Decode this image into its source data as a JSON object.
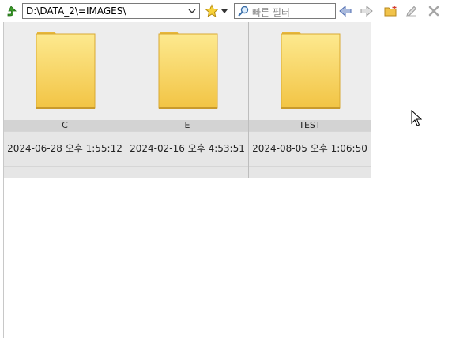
{
  "toolbar": {
    "path": "D:\\DATA_2\\=IMAGES\\",
    "filter_placeholder": "빠른 필터"
  },
  "tiles": [
    {
      "name": "C",
      "date": "2024-06-28 오후 1:55:12"
    },
    {
      "name": "E",
      "date": "2024-02-16 오후 4:53:51"
    },
    {
      "name": "TEST",
      "date": "2024-08-05 오후 1:06:50"
    }
  ],
  "colors": {
    "folder_top": "#fde58a",
    "folder_bottom": "#f3c84a",
    "tile_bg": "#e6e6e6",
    "up_arrow": "#4aa02c"
  }
}
